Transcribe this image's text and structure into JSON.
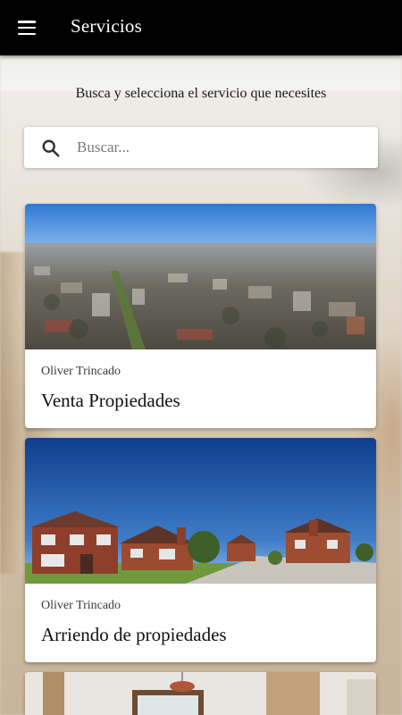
{
  "appbar": {
    "title": "Servicios",
    "menu_icon": "hamburger-menu-icon"
  },
  "subtitle": "Busca y selecciona el servicio que necesites",
  "search": {
    "placeholder": "Buscar...",
    "value": "",
    "icon": "search-icon"
  },
  "services": [
    {
      "author": "Oliver Trincado",
      "title": "Venta Propiedades",
      "image": "aerial-city-photo"
    },
    {
      "author": "Oliver Trincado",
      "title": "Arriendo de propiedades",
      "image": "brick-houses-photo"
    },
    {
      "author": "",
      "title": "",
      "image": "interior-room-photo"
    }
  ],
  "colors": {
    "appbar_bg": "#000000",
    "card_bg": "#ffffff",
    "text_primary": "#111111"
  }
}
